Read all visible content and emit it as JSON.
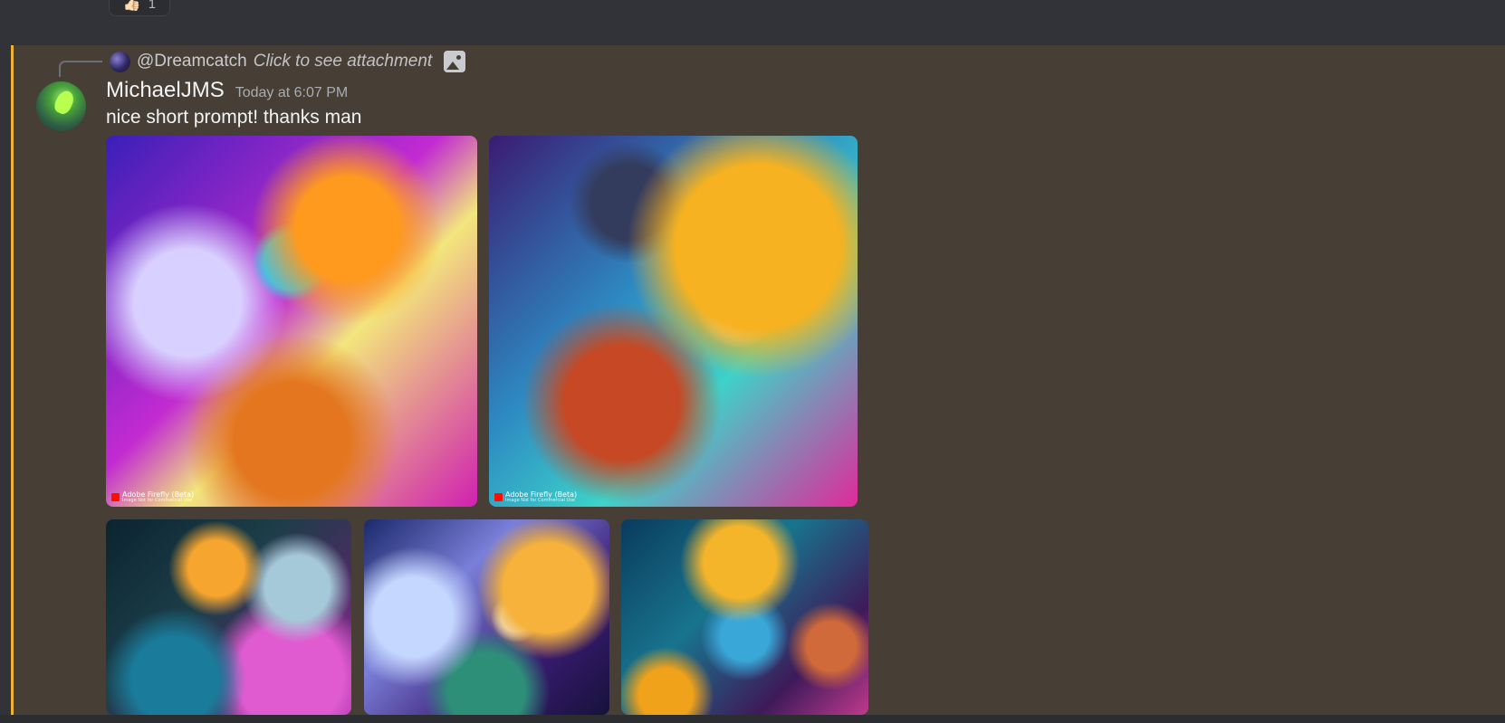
{
  "previous_message": {
    "reaction": {
      "emoji": "👍🏻",
      "count": "1"
    }
  },
  "message": {
    "reply": {
      "username": "@Dreamcatch",
      "text": "Click to see attachment",
      "icon": "image-icon"
    },
    "author": "MichaelJMS",
    "timestamp": "Today at 6:07 PM",
    "content": "nice short prompt! thanks man",
    "highlight_color": "#f0b232",
    "background_color": "#473f35",
    "attachments": [
      {
        "label": "Adobe Firefly (Beta)",
        "sublabel": "Image Not for Commercial Use"
      },
      {
        "label": "Adobe Firefly (Beta)",
        "sublabel": "Image Not for Commercial Use"
      },
      {
        "label": ""
      },
      {
        "label": ""
      },
      {
        "label": ""
      }
    ]
  },
  "colors": {
    "app_background": "#313338",
    "text_primary": "#f2f3f5",
    "text_muted": "#a9acb2"
  }
}
